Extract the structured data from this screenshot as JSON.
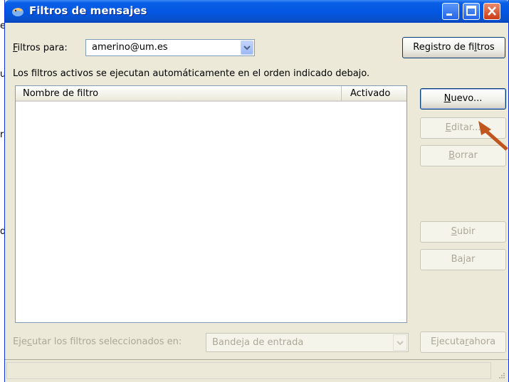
{
  "window": {
    "title": "Filtros de mensajes"
  },
  "filters_for": {
    "label_accel": "F",
    "label_rest": "iltros para:",
    "value": "amerino@um.es"
  },
  "buttons": {
    "registro_a": "Registro de fi",
    "registro_accel": "l",
    "registro_b": "tros",
    "nuevo_accel": "N",
    "nuevo_rest": "uevo...",
    "editar_accel": "E",
    "editar_rest": "ditar...",
    "borrar_accel": "B",
    "borrar_rest": "orrar",
    "subir_accel": "S",
    "subir_rest": "ubir",
    "bajar_a": "Ba",
    "bajar_accel": "j",
    "bajar_b": "ar",
    "ejecutar_ahora_a": "Ejecuta",
    "ejecutar_ahora_accel": "r",
    "ejecutar_ahora_b": " ahora"
  },
  "info_text": "Los filtros activos se ejecutan automáticamente en el orden indicado debajo.",
  "list": {
    "columns": [
      "Nombre de filtro",
      "Activado"
    ],
    "rows": []
  },
  "run_selected": {
    "label_a": "Eje",
    "label_accel": "c",
    "label_b": "utar los filtros seleccionados en:",
    "folder_value": "Bandeja de entrada"
  },
  "background_chars": [
    "e",
    "u",
    "r",
    "d"
  ],
  "colors": {
    "titlebar": "#0256e2",
    "dialog_bg": "#ece9d8",
    "annotation_arrow": "#c0561e"
  },
  "icons": {
    "app": "thunderbird-icon",
    "minimize": "minimize-icon",
    "maximize": "maximize-icon",
    "close": "close-icon",
    "dropdown": "chevron-down-icon",
    "annotation": "pointer-arrow-icon"
  }
}
